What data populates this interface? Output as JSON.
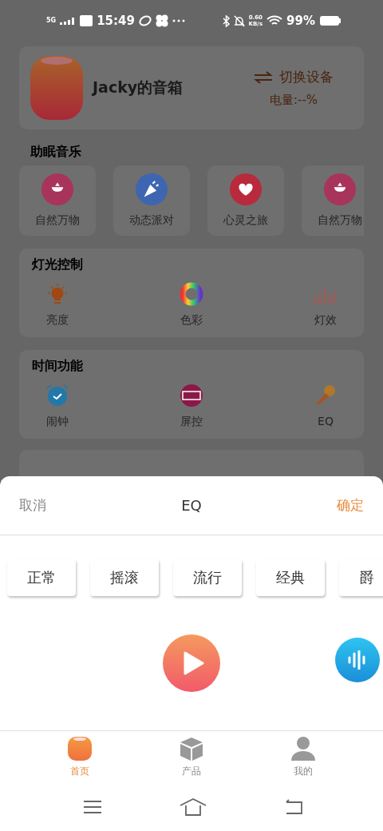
{
  "status_bar": {
    "network": "5G",
    "time": "15:49",
    "speed_value": "0.60",
    "speed_unit": "KB/s",
    "battery": "99%"
  },
  "device": {
    "name": "Jacky的音箱",
    "switch_label": "切换设备",
    "battery": "电量:--%"
  },
  "sleep_music": {
    "title": "助眠音乐",
    "items": [
      {
        "label": "自然万物",
        "kind": "flower",
        "color": "#a8345c"
      },
      {
        "label": "动态派对",
        "kind": "party",
        "color": "#3e66b0"
      },
      {
        "label": "心灵之旅",
        "kind": "heart",
        "color": "#b82a3c"
      },
      {
        "label": "自然万物",
        "kind": "flower",
        "color": "#a8345c"
      }
    ]
  },
  "sections": [
    {
      "title": "灯光控制",
      "items": [
        {
          "label": "亮度",
          "kind": "bulb"
        },
        {
          "label": "色彩",
          "kind": "wheel"
        },
        {
          "label": "灯效",
          "kind": "bars"
        }
      ]
    },
    {
      "title": "时间功能",
      "items": [
        {
          "label": "闹钟",
          "kind": "alarm"
        },
        {
          "label": "屏控",
          "kind": "led"
        },
        {
          "label": "EQ",
          "kind": "mic"
        }
      ]
    }
  ],
  "sheet": {
    "cancel": "取消",
    "title": "EQ",
    "confirm": "确定",
    "presets": [
      "正常",
      "摇滚",
      "流行",
      "经典",
      "爵"
    ]
  },
  "tabs": [
    {
      "label": "首页",
      "kind": "home",
      "selected": true
    },
    {
      "label": "产品",
      "kind": "box",
      "selected": false
    },
    {
      "label": "我的",
      "kind": "user",
      "selected": false
    }
  ]
}
